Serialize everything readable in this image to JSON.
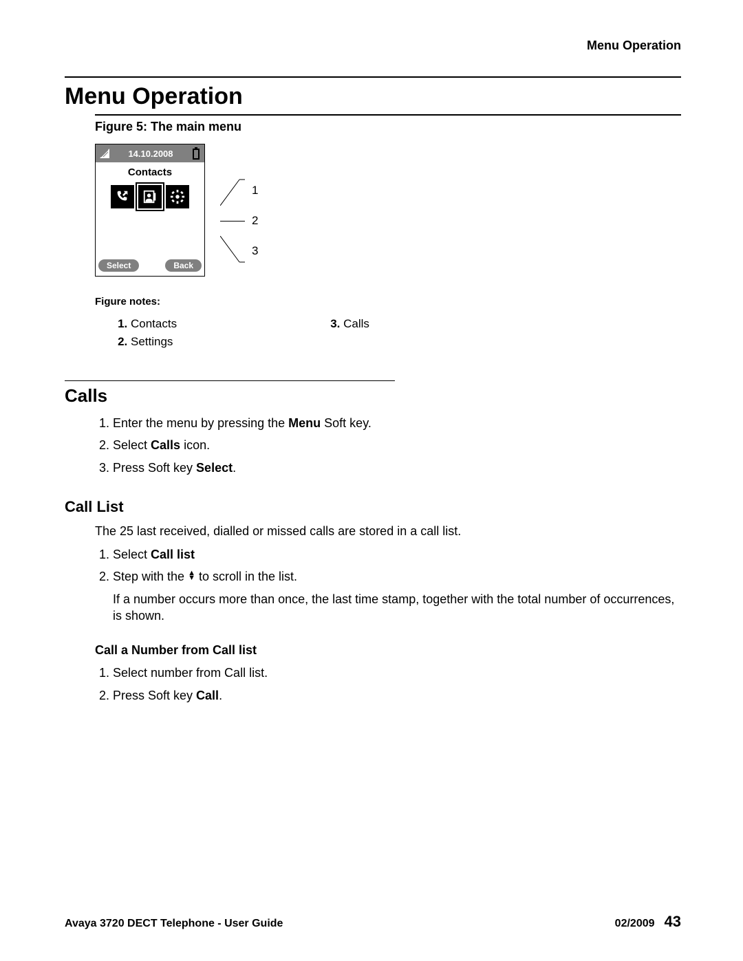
{
  "running_head": "Menu Operation",
  "title": "Menu Operation",
  "figure": {
    "caption": "Figure 5: The main menu",
    "date": "14.10.2008",
    "screen_title": "Contacts",
    "softkey_left": "Select",
    "softkey_right": "Back",
    "callouts": [
      "1",
      "2",
      "3"
    ],
    "notes_label": "Figure notes:",
    "notes_col1": [
      "Contacts",
      "Settings"
    ],
    "notes_col2_start": 3,
    "notes_col2": [
      "Calls"
    ]
  },
  "calls": {
    "heading": "Calls",
    "steps": [
      {
        "pre": "Enter the menu by pressing the ",
        "bold": "Menu",
        "post": " Soft key."
      },
      {
        "pre": "Select ",
        "bold": "Calls",
        "post": " icon."
      },
      {
        "pre": "Press Soft key ",
        "bold": "Select",
        "post": "."
      }
    ]
  },
  "call_list": {
    "heading": "Call List",
    "intro": "The 25 last received, dialled or missed calls are stored in a call list.",
    "steps": {
      "s1": {
        "pre": "Select ",
        "bold": "Call list"
      },
      "s2": {
        "pre": "Step with the ",
        "post": " to scroll in the list."
      },
      "s2_sub": "If a number occurs more than once, the last time stamp, together with the total number of occurrences, is shown."
    }
  },
  "call_number": {
    "heading": "Call a Number from Call list",
    "steps": [
      {
        "text": "Select number from Call list."
      },
      {
        "pre": "Press Soft key ",
        "bold": "Call",
        "post": "."
      }
    ]
  },
  "footer": {
    "left": "Avaya 3720 DECT Telephone - User Guide",
    "date": "02/2009",
    "page": "43"
  }
}
